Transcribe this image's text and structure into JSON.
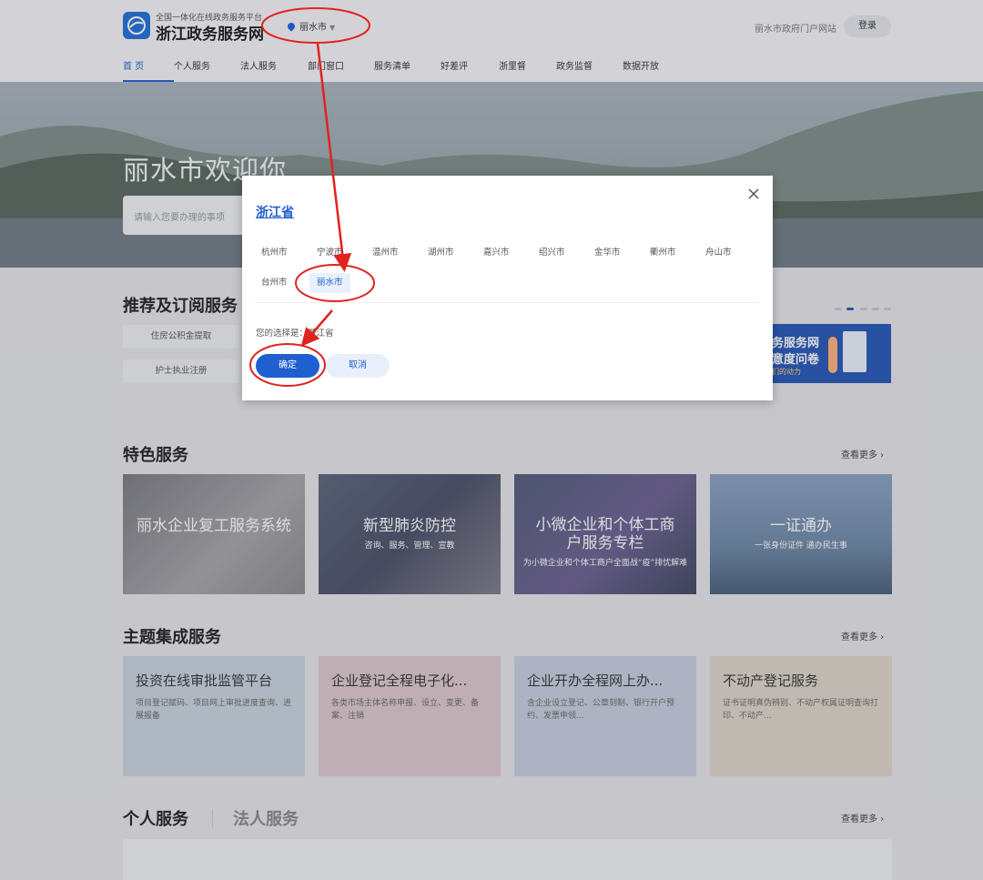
{
  "header": {
    "logo_subtitle": "全国一体化在线政务服务平台",
    "logo_title": "浙江政务服务网",
    "city": "丽水市",
    "portal_link": "丽水市政府门户网站",
    "login": "登录"
  },
  "nav": [
    "首 页",
    "个人服务",
    "法人服务",
    "部门窗口",
    "服务清单",
    "好差评",
    "浙里督",
    "政务监督",
    "数据开放"
  ],
  "hero": {
    "title": "丽水市欢迎你",
    "search_placeholder": "请输入您要办理的事项"
  },
  "recommend": {
    "title": "推荐及订阅服务",
    "items": [
      "住房公积金提取",
      "护士执业注册"
    ],
    "banner": {
      "line1": "务服务网",
      "line2": "意度问卷",
      "line3": "们的动力"
    }
  },
  "featured": {
    "title": "特色服务",
    "more": "查看更多",
    "cards": [
      {
        "title": "丽水企业复工服务系统",
        "sub": ""
      },
      {
        "title": "新型肺炎防控",
        "sub": "咨询、服务、管理、宣教"
      },
      {
        "title": "小微企业和个体工商户服务专栏",
        "sub": "为小微企业和个体工商户全面战“疫”排忧解难"
      },
      {
        "title": "一证通办",
        "sub": "一张身份证件 通办民生事"
      }
    ]
  },
  "themes": {
    "title": "主题集成服务",
    "more": "查看更多",
    "cards": [
      {
        "title": "投资在线审批监管平台",
        "desc": "项目登记赋码、项目网上审批进度查询、进展报备"
      },
      {
        "title": "企业登记全程电子化...",
        "desc": "各类市场主体名称申报、设立、变更、备案、注销"
      },
      {
        "title": "企业开办全程网上办...",
        "desc": "含企业设立登记、公章刻制、银行开户预约、发票申领..."
      },
      {
        "title": "不动产登记服务",
        "desc": "证书证明真伪辨别、不动产权属证明查询打印、不动产..."
      }
    ]
  },
  "bottom_tabs": {
    "personal": "个人服务",
    "legal": "法人服务",
    "more": "查看更多"
  },
  "modal": {
    "province": "浙江省",
    "cities": [
      "杭州市",
      "宁波市",
      "温州市",
      "湖州市",
      "嘉兴市",
      "绍兴市",
      "金华市",
      "衢州市",
      "舟山市",
      "台州市",
      "丽水市"
    ],
    "selected_city": "丽水市",
    "choice_label": "您的选择是：",
    "choice_value": "浙江省",
    "confirm": "确定",
    "cancel": "取消"
  },
  "colors": {
    "accent": "#1f5fd0",
    "annotation": "#e0231f"
  }
}
